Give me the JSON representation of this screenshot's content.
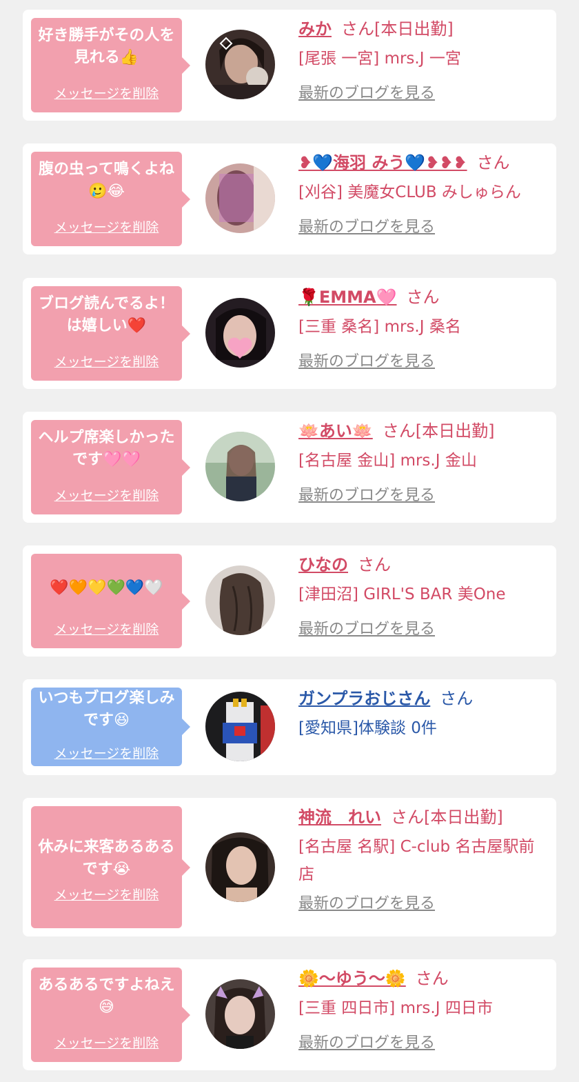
{
  "colors": {
    "page_bg": "#f0f0f0",
    "card_bg": "#ffffff",
    "bubble_pink": "#f2a0ae",
    "bubble_blue": "#8fb5ef",
    "name_pink": "#d24a65",
    "name_blue": "#2a58a8",
    "blog_gray": "#888888"
  },
  "delete_label": "メッセージを削除",
  "blog_label": "最新のブログを見る",
  "cards": [
    {
      "message": "好き勝手がその人を見れる👍",
      "name": "みか",
      "suffix": "さん[本日出勤]",
      "shop": "[尾張 一宮] mrs.J 一宮",
      "avatar": "selfie-with-cat-sticker"
    },
    {
      "message": "腹の虫って鳴くよね🥲😂",
      "name": "❥💙海羽 みう💙❥❥❥",
      "suffix": "さん",
      "shop": "[刈谷] 美魔女CLUB みしゅらん",
      "avatar": "blurred-portrait"
    },
    {
      "message": "ブログ読んでるよ！は嬉しい❤️",
      "name": "🌹EMMA🩷",
      "suffix": "さん",
      "shop": "[三重 桑名] mrs.J 桑名",
      "avatar": "portrait-with-heart-sticker"
    },
    {
      "message": "ヘルプ席楽しかったです🩷🩷",
      "name": "🪷あい🪷",
      "suffix": "さん[本日出勤]",
      "shop": "[名古屋 金山] mrs.J 金山",
      "avatar": "outdoor-portrait"
    },
    {
      "message": "❤️🧡💛💚💙🤍",
      "name": "ひなの",
      "suffix": "さん",
      "shop": "[津田沼] GIRL'S BAR 美One",
      "avatar": "back-of-head-hair"
    },
    {
      "message": "いつもブログ楽しみです😆",
      "name": "ガンプラおじさん",
      "suffix": "さん",
      "shop": "[愛知県]体験談 0件",
      "avatar": "gundam-model"
    },
    {
      "message": "休みに来客あるあるです😭",
      "name": "神流　れい",
      "suffix": "さん[本日出勤]",
      "shop": "[名古屋 名駅] C-club 名古屋駅前店",
      "avatar": "portrait-close-up"
    },
    {
      "message": "あるあるですよねえ😅",
      "name": "🌼〜ゆう〜🌼",
      "suffix": "さん",
      "shop": "[三重 四日市] mrs.J 四日市",
      "avatar": "portrait-with-bunny-ears"
    }
  ]
}
